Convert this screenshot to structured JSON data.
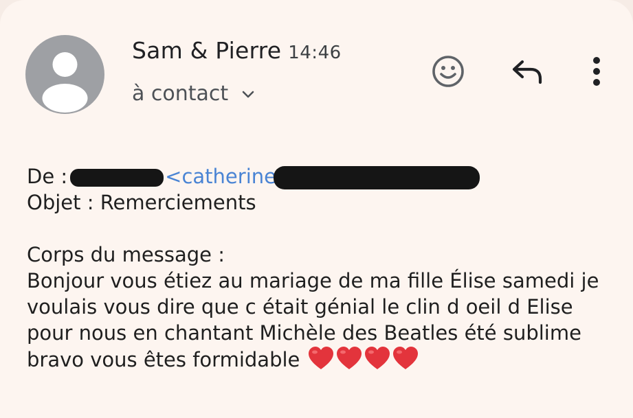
{
  "header": {
    "sender_name": "Sam & Pierre",
    "time": "14:46",
    "recipient": "à contact"
  },
  "icons": {
    "avatar": "person-avatar-icon",
    "chevron": "chevron-down-icon",
    "emoji": "smiley-icon",
    "reply": "reply-icon",
    "more": "more-vertical-icon"
  },
  "message": {
    "from_label": "De :",
    "from_email_visible": "<catherine",
    "subject_line": "Objet : Remerciements",
    "body_label": "Corps du message :",
    "body_lines": [
      "Bonjour vous étiez au mariage de ma fille Élise  samedi je",
      "voulais vous dire que c était génial  le clin d oeil d Elise",
      "pour nous en chantant Michèle des Beatles été sublime",
      "bravo vous êtes formidable"
    ],
    "hearts": [
      "❤️",
      "❤️",
      "❤️",
      "❤️"
    ]
  },
  "colors": {
    "background": "#fdf5f0",
    "link": "#4a84d4",
    "heart": "#e3343c",
    "avatar": "#9ea0a4"
  }
}
